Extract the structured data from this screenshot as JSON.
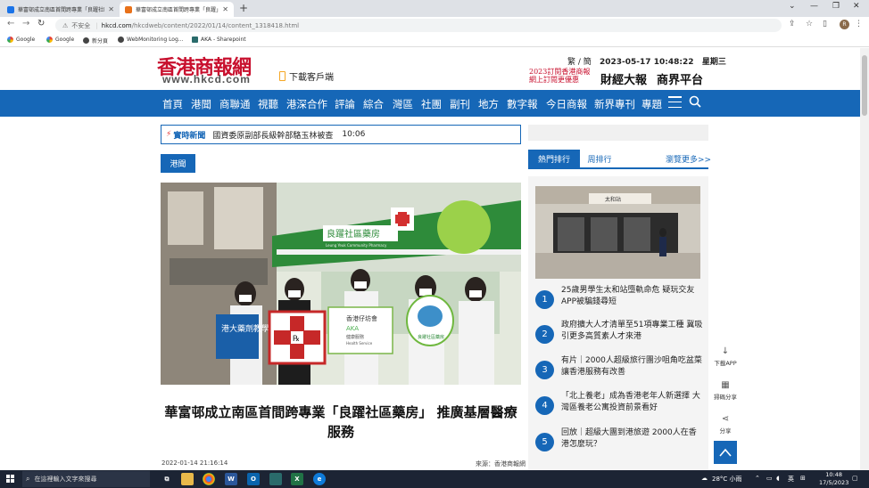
{
  "browser": {
    "tabs": [
      {
        "title": "華富邨成立南區首間跨專業「良躍社區藥房」推廣基層醫療 - 香港商報",
        "active": false
      },
      {
        "title": "華富邨成立南區首間跨專業「良躍」",
        "active": true
      }
    ],
    "address": {
      "insecure_label": "不安全",
      "domain": "hkcd.com",
      "path": "/hkcdweb/content/2022/01/14/content_1318418.html"
    },
    "bookmarks": [
      "Google",
      "Google",
      "新分頁",
      "WebMonitoring Log...",
      "AKA - Sharepoint"
    ],
    "avatar_letter": "R"
  },
  "site": {
    "logo_text": "香港商報網",
    "logo_url": "www.hkcd.com",
    "download_app": "下載客戶端",
    "lang": "繁 / 簡",
    "date": "2023-05-17",
    "time": "10:48:22",
    "weekday": "星期三",
    "promo_line1": "2023訂閱香港商報",
    "promo_line2": "網上訂閱更優惠",
    "brand1": "財經大報",
    "brand2": "商界平台"
  },
  "nav": {
    "items": [
      "首頁",
      "港聞",
      "商聯通",
      "視聽",
      "港深合作",
      "評論",
      "綜合",
      "灣區",
      "社團",
      "副刊",
      "地方",
      "數字報",
      "今日商報",
      "新界專刊",
      "專題"
    ]
  },
  "ticker": {
    "label": "實時新聞",
    "text": "國資委原副部長級幹部駱玉林被查",
    "time": "10:06"
  },
  "article": {
    "category": "港聞",
    "headline": "華富邨成立南區首間跨專業「良躍社區藥房」 推廣基層醫療服務",
    "date": "2022-01-14 21:16:14",
    "source": "來源：香港商報網",
    "photo_signs": {
      "shop_name": "良躍社區藥房",
      "shop_name_en": "Leung Yeuk Community Pharmacy",
      "board1": "港大藥劑教學藥房",
      "board3_line1": "香港仔坊會",
      "board3_line2": "AKA",
      "board3_line3": "健康服務",
      "board3_line4": "Health Service",
      "board4": "良躍社區藥房"
    }
  },
  "sidebar": {
    "tab_hot": "熱門排行",
    "tab_week": "周排行",
    "more": "瀏覽更多>>",
    "ranking": [
      {
        "num": "1",
        "text": "25歲男學生太和站墮軌命危 疑玩交友APP被騙錢尋短"
      },
      {
        "num": "2",
        "text": "政府擴大人才清單至51項專業工種 冀吸引更多高質素人才來港"
      },
      {
        "num": "3",
        "text": "有片｜2000人超級旅行團沙咀角吃盆菜 讓香港服務有改善"
      },
      {
        "num": "4",
        "text": "「北上養老」成為香港老年人新選擇 大灣區養老公寓投資前景看好"
      },
      {
        "num": "5",
        "text": "回放｜超級大團到港旅遊 2000人在香港怎麼玩？"
      }
    ],
    "station_sign": "太和站"
  },
  "floatbar": {
    "download": "下載APP",
    "share_wechat": "掃碼分享",
    "share": "分享"
  },
  "taskbar": {
    "search_placeholder": "在這裡輸入文字來搜尋",
    "weather": "28°C 小雨",
    "ime": "英",
    "time": "10:48",
    "date": "17/5/2023"
  }
}
